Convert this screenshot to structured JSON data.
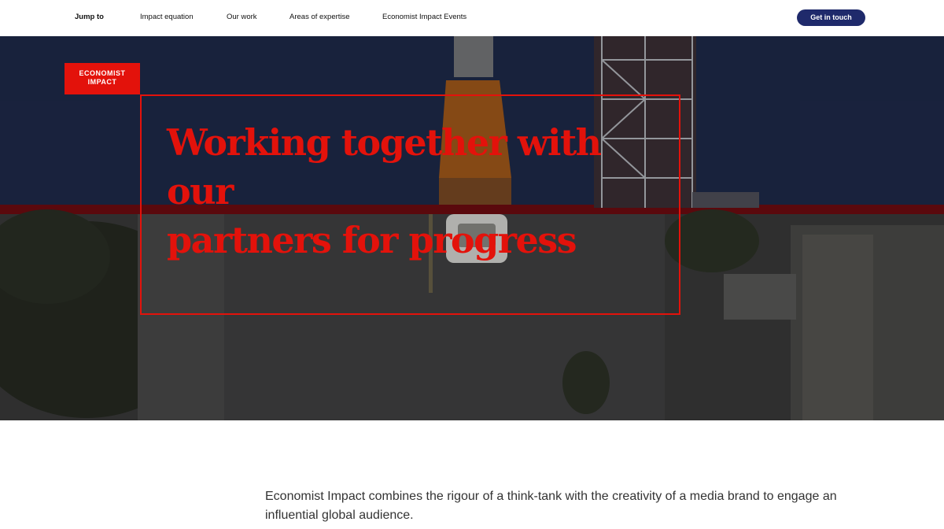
{
  "nav": {
    "jump_label": "Jump to",
    "items": [
      "Impact equation",
      "Our work",
      "Areas of expertise",
      "Economist Impact Events"
    ],
    "cta_label": "Get in touch"
  },
  "hero": {
    "logo_line1": "ECONOMIST",
    "logo_line2": "IMPACT",
    "headline_line1": "Working together with our",
    "headline_line2": "partners for progress"
  },
  "intro": {
    "text": "Economist Impact combines the rigour of a think-tank with the creativity of a media brand to engage an influential global audience."
  },
  "colors": {
    "brand_red": "#e3120b",
    "cta_navy": "#1f2a6b",
    "sky_navy": "#1e2a4a"
  }
}
